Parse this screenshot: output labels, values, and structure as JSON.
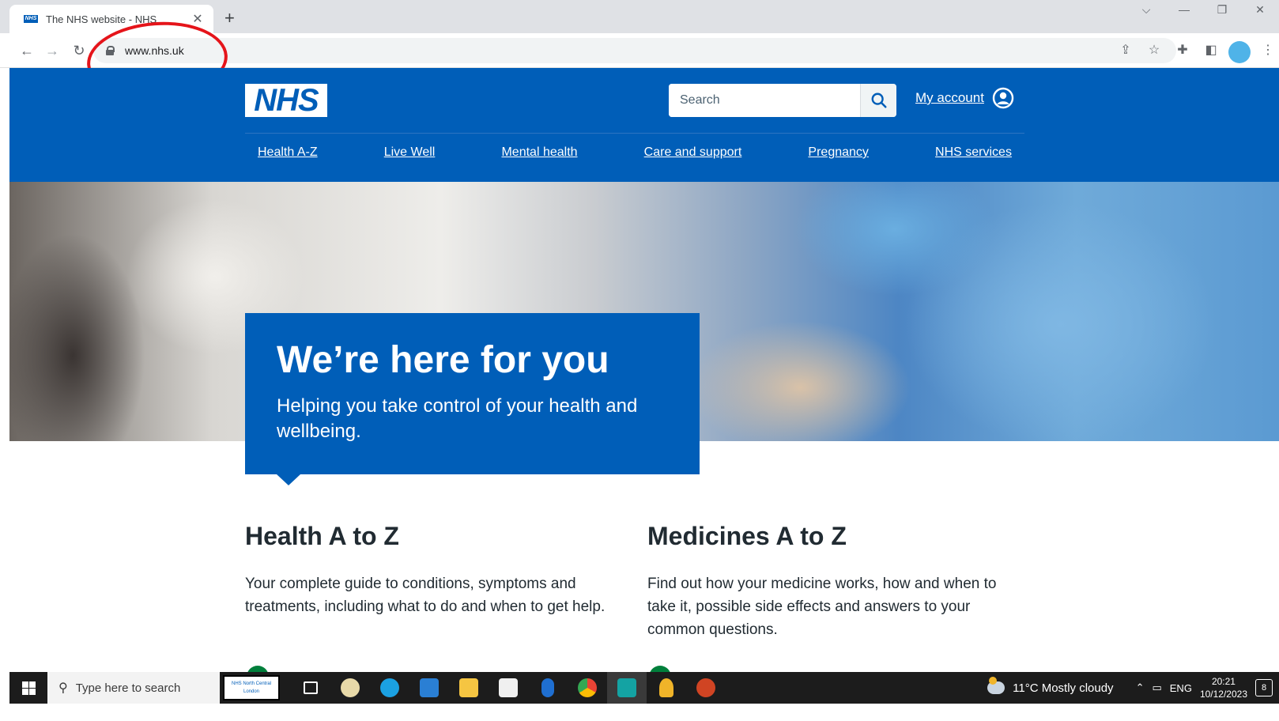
{
  "browser": {
    "tab_title": "The NHS website - NHS",
    "tab_favicon_text": "NHS",
    "tab_close": "✕",
    "new_tab": "+",
    "url": "www.nhs.uk",
    "window_controls": [
      "⌵",
      "—",
      "❐",
      "✕"
    ]
  },
  "header": {
    "logo_text": "NHS",
    "search_placeholder": "Search",
    "account_label": "My account",
    "brand_color": "#005eb8"
  },
  "nav": {
    "items": [
      {
        "label": "Health A-Z"
      },
      {
        "label": "Live Well"
      },
      {
        "label": "Mental health"
      },
      {
        "label": "Care and support"
      },
      {
        "label": "Pregnancy"
      },
      {
        "label": "NHS services"
      }
    ]
  },
  "hero": {
    "title": "We’re here for you",
    "subtitle": "Helping you take control of your health and wellbeing."
  },
  "cards": [
    {
      "title": "Health A to Z",
      "text": "Your complete guide to conditions, symptoms and treatments, including what to do and when to get help."
    },
    {
      "title": "Medicines A to Z",
      "text": "Find out how your medicine works, how and when to take it, possible side effects and answers to your common questions."
    }
  ],
  "taskbar": {
    "search_placeholder": "Type here to search",
    "pinned_logo_text": "NHS North Central London",
    "weather": "11°C  Mostly cloudy",
    "language": "ENG",
    "time": "20:21",
    "date": "10/12/2023",
    "notification_count": "8"
  }
}
